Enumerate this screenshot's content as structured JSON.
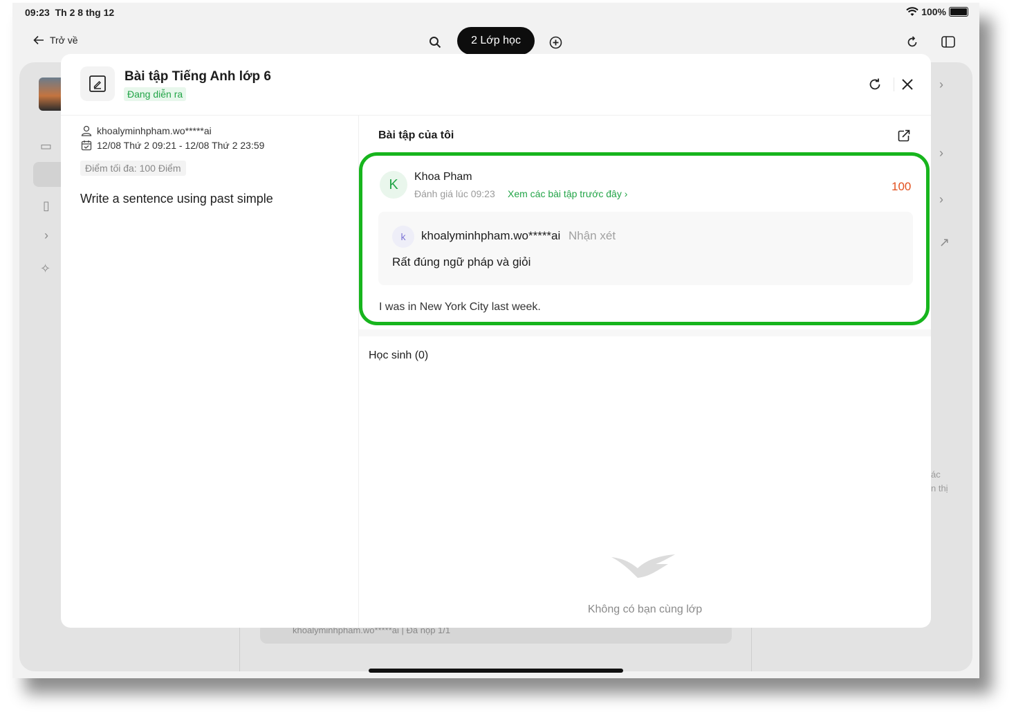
{
  "status_bar": {
    "time": "09:23",
    "date": "Th 2 8 thg 12",
    "battery": "100%"
  },
  "toolbar": {
    "back_label": "Trở về",
    "class_pill": "2 Lớp học"
  },
  "background": {
    "footer_text": "khoalyminhpham.wo*****ai  |  Đã nộp  1/1",
    "right_text_1": "ác",
    "right_text_2": "n thị"
  },
  "modal": {
    "title": "Bài tập Tiếng Anh lớp 6",
    "status": "Đang diễn ra",
    "status_color": "#22a447",
    "author": "khoalyminhpham.wo*****ai",
    "date_range": "12/08 Thứ 2 09:21 - 12/08 Thứ 2 23:59",
    "max_score": "Điểm tối đa: 100 Điểm",
    "question": "Write a sentence using past simple",
    "my_work": {
      "heading": "Bài tập của tôi",
      "student_initial": "K",
      "student_name": "Khoa Pham",
      "graded_at": "Đánh giá lúc 09:23",
      "prev_link": "Xem các bài tập trước đây",
      "score": "100",
      "score_color": "#e2501e",
      "highlight_color": "#17b51d",
      "comment": {
        "initial": "k",
        "author": "khoalyminhpham.wo*****ai",
        "label": "Nhận xét",
        "text": "Rất đúng ngữ pháp và giỏi"
      },
      "answer": "I was in New York City last week."
    },
    "students": {
      "heading": "Học sinh (0)",
      "empty_text": "Không có bạn cùng lớp"
    }
  }
}
